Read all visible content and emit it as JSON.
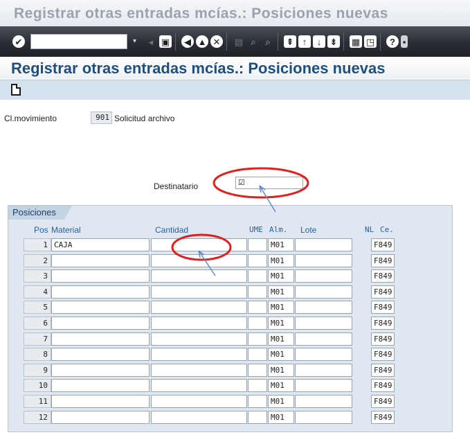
{
  "window_title": "Registrar otras entradas mcías.: Posiciones nuevas",
  "screen_title": "Registrar otras entradas mcías.: Posiciones nuevas",
  "toolbar": {
    "command_field_value": "",
    "icons": [
      "enter-icon",
      "save-icon",
      "back-icon",
      "exit-icon",
      "cancel-icon",
      "print-icon",
      "find-icon",
      "find-next-icon",
      "first-page-icon",
      "previous-page-icon",
      "next-page-icon",
      "last-page-icon",
      "new-session-icon",
      "shortcut-icon",
      "help-icon",
      "layout-menu-icon"
    ]
  },
  "header": {
    "movement_label": "Cl.movimiento",
    "movement_code": "901",
    "movement_text": "Solicitud archivo",
    "recipient_label": "Destinatario",
    "recipient_checkbox": "☑"
  },
  "positions": {
    "title": "Posiciones",
    "columns": {
      "pos": "Pos",
      "material": "Material",
      "quantity": "Cantidad",
      "unit": "UME",
      "storage": "Alm.",
      "batch": "Lote",
      "nl": "NL",
      "plant": "Ce."
    },
    "rows": [
      {
        "pos": "1",
        "material": "CAJA",
        "quantity": "",
        "unit": "",
        "storage": "M01",
        "batch": "",
        "plant": "F849"
      },
      {
        "pos": "2",
        "material": "",
        "quantity": "",
        "unit": "",
        "storage": "M01",
        "batch": "",
        "plant": "F849"
      },
      {
        "pos": "3",
        "material": "",
        "quantity": "",
        "unit": "",
        "storage": "M01",
        "batch": "",
        "plant": "F849"
      },
      {
        "pos": "4",
        "material": "",
        "quantity": "",
        "unit": "",
        "storage": "M01",
        "batch": "",
        "plant": "F849"
      },
      {
        "pos": "5",
        "material": "",
        "quantity": "",
        "unit": "",
        "storage": "M01",
        "batch": "",
        "plant": "F849"
      },
      {
        "pos": "6",
        "material": "",
        "quantity": "",
        "unit": "",
        "storage": "M01",
        "batch": "",
        "plant": "F849"
      },
      {
        "pos": "7",
        "material": "",
        "quantity": "",
        "unit": "",
        "storage": "M01",
        "batch": "",
        "plant": "F849"
      },
      {
        "pos": "8",
        "material": "",
        "quantity": "",
        "unit": "",
        "storage": "M01",
        "batch": "",
        "plant": "F849"
      },
      {
        "pos": "9",
        "material": "",
        "quantity": "",
        "unit": "",
        "storage": "M01",
        "batch": "",
        "plant": "F849"
      },
      {
        "pos": "10",
        "material": "",
        "quantity": "",
        "unit": "",
        "storage": "M01",
        "batch": "",
        "plant": "F849"
      },
      {
        "pos": "11",
        "material": "",
        "quantity": "",
        "unit": "",
        "storage": "M01",
        "batch": "",
        "plant": "F849"
      },
      {
        "pos": "12",
        "material": "",
        "quantity": "",
        "unit": "",
        "storage": "M01",
        "batch": "",
        "plant": "F849"
      }
    ]
  },
  "colors": {
    "annotation_red": "#e0201c",
    "annotation_arrow": "#6b88c9",
    "title_blue": "#1f4f7c"
  }
}
